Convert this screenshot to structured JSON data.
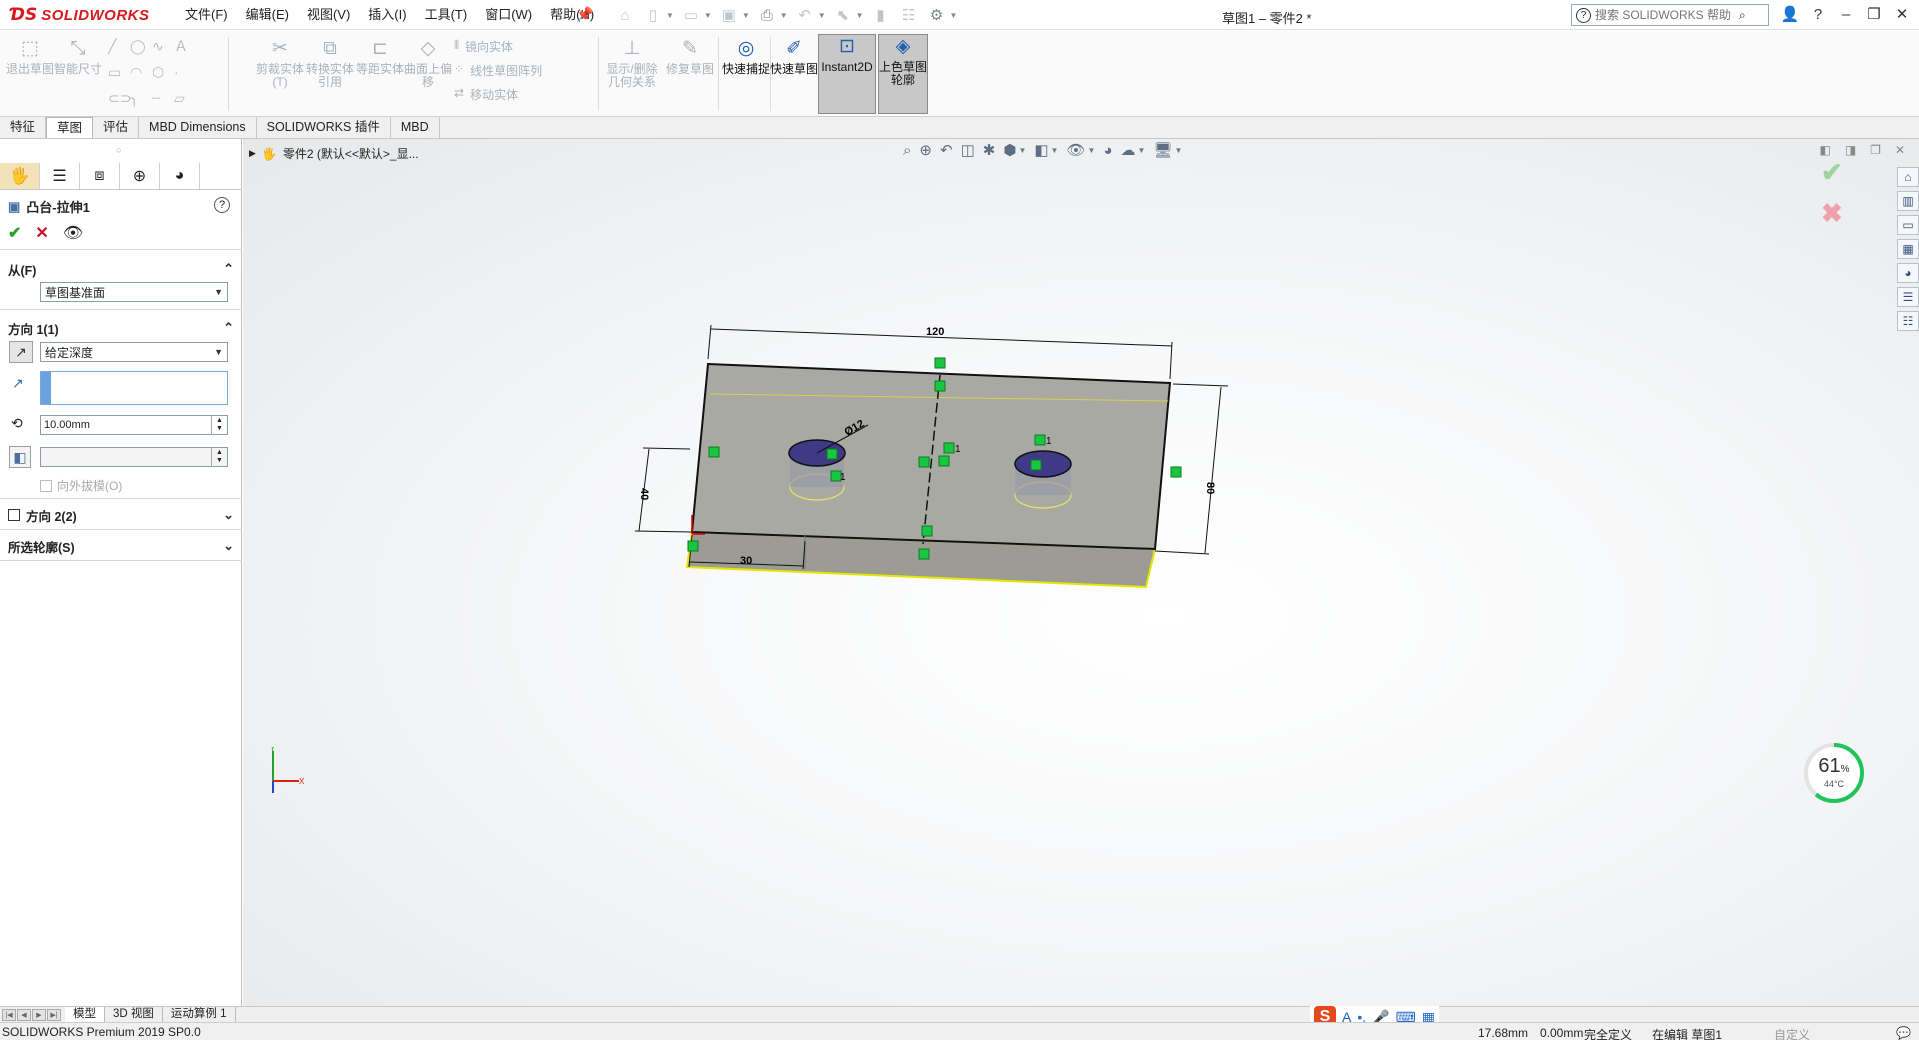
{
  "app": {
    "logo_text": "SOLIDWORKS",
    "doc_title": "草图1 – 零件2 *",
    "search_placeholder": "搜索 SOLIDWORKS 帮助",
    "brand_color": "#d71920"
  },
  "menus": [
    "文件(F)",
    "编辑(E)",
    "视图(V)",
    "插入(I)",
    "工具(T)",
    "窗口(W)",
    "帮助(H)"
  ],
  "ribbon": {
    "exit_sketch": "退出草图",
    "smart_dim": "智能尺寸",
    "trim": "剪裁实体(T)",
    "convert": "转换实体引用",
    "offset": "等距实体",
    "offset_surface": "曲面上偏移",
    "mirror": "镜向实体",
    "linear_pattern": "线性草图阵列",
    "move": "移动实体",
    "display_relations": "显示/删除几何关系",
    "repair": "修复草图",
    "rapid_snap": "快速捕捉",
    "rapid_sketch": "快速草图",
    "instant2d": "Instant2D",
    "shaded_contours": "上色草图轮廓"
  },
  "command_tabs": [
    "特征",
    "草图",
    "评估",
    "MBD Dimensions",
    "SOLIDWORKS 插件",
    "MBD"
  ],
  "active_command_tab": "草图",
  "property_manager": {
    "title": "凸台-拉伸1",
    "from_label": "从(F)",
    "from_value": "草图基准面",
    "direction1_label": "方向 1(1)",
    "end_condition": "给定深度",
    "depth_value": "10.00mm",
    "draft_outward": "向外拔模(O)",
    "direction2_label": "方向 2(2)",
    "selected_contours_label": "所选轮廓(S)"
  },
  "graphics": {
    "tree_item": "零件2 (默认<<默认>_显...",
    "dims": {
      "width": "120",
      "height": "80",
      "hole_dia": "Ø12",
      "left_offset": "30",
      "vertical_offset": "40"
    },
    "relation_tag": "1"
  },
  "gauge": {
    "percent": "61",
    "percent_sign": "%",
    "temp": "44°C",
    "level": 0.61
  },
  "bottom_tabs": [
    "模型",
    "3D 视图",
    "运动算例 1"
  ],
  "active_bottom_tab": "模型",
  "status": {
    "product": "SOLIDWORKS Premium 2019 SP0.0",
    "x": "17.68mm",
    "y": "0.00mm",
    "state": "完全定义",
    "editing": "在编辑 草图1",
    "custom": "自定义"
  }
}
